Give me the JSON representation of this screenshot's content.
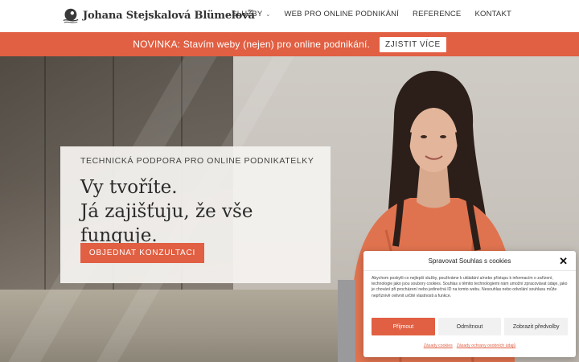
{
  "header": {
    "logo_text": "Johana Stejskalová Blümelová",
    "nav": [
      {
        "label": "SLUŽBY",
        "has_dropdown": true
      },
      {
        "label": "WEB PRO ONLINE PODNIKÁNÍ"
      },
      {
        "label": "REFERENCE"
      },
      {
        "label": "KONTAKT"
      }
    ]
  },
  "announcement": {
    "text": "NOVINKA: Stavím weby (nejen) pro online podnikání.",
    "button": "ZJISTIT VÍCE"
  },
  "hero": {
    "kicker": "TECHNICKÁ PODPORA PRO ONLINE PODNIKATELKY",
    "title_line1": "Vy tvoříte.",
    "title_line2": "Já zajišťuju, že vše funguje.",
    "cta": "OBJEDNAT KONZULTACI"
  },
  "cookie": {
    "title": "Spravovat Souhlas s cookies",
    "body": "Abychom poskytli co nejlepší služby, používáme k ukládání a/nebo přístupu k informacím o zařízení, technologie jako jsou soubory cookies. Souhlas s těmito technologiemi nám umožní zpracovávat údaje, jako je chování při procházení nebo jedinečná ID na tomto webu. Nesouhlas nebo odvolání souhlasu může nepříznivě ovlivnit určité vlastnosti a funkce.",
    "accept": "Přijmout",
    "deny": "Odmítnout",
    "prefs": "Zobrazit předvolby",
    "link1": "Zásady cookies",
    "link2": "Zásady ochrany osobních údajů"
  },
  "colors": {
    "accent": "#e15f42",
    "text": "#333333"
  }
}
